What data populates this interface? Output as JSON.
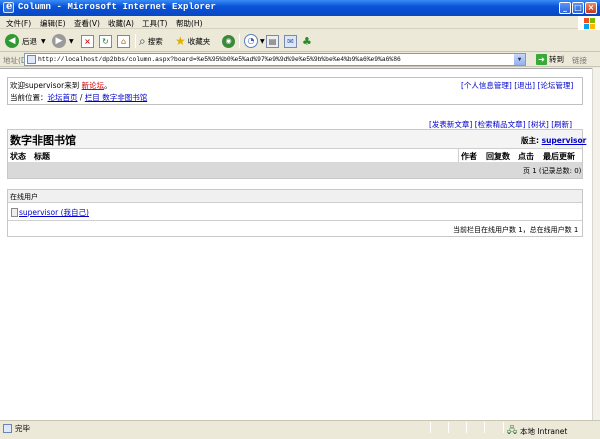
{
  "window": {
    "title": "Column - Microsoft Internet Explorer",
    "buttons": {
      "minimize": "_",
      "maximize": "□",
      "close": "×"
    }
  },
  "menu": [
    "文件(F)",
    "编辑(E)",
    "查看(V)",
    "收藏(A)",
    "工具(T)",
    "帮助(H)"
  ],
  "toolbar": {
    "back_label": "后退",
    "search_label": "搜索",
    "favorites_label": "收藏夹"
  },
  "address": {
    "label": "地址(D)",
    "url": "http://localhost/dp2bbs/column.aspx?board=%e5%95%b0%e5%ad%97%e9%9d%9e%e5%9b%be%e4%b9%a6%e9%a6%86",
    "go_label": "转到",
    "links_label": "链接"
  },
  "page": {
    "welcome_prefix": "欢迎",
    "user": "supervisor",
    "welcome_suffix": "来到",
    "forum_name": "新论坛",
    "welcome_end": "。",
    "top_links": [
      "[个人信息管理]",
      "[退出]",
      "[论坛管理]"
    ],
    "location_label": "当前位置：",
    "crumb_home": "论坛首页",
    "crumb_sep": "/",
    "crumb_column": "栏目 数字非图书馆",
    "actions": [
      "[发表新文章]",
      "[检索精品文章]",
      "[树状]",
      "[刷新]"
    ],
    "board_title": "数字非图书馆",
    "moderator_label": "版主:",
    "moderator": "supervisor",
    "columns": {
      "status": "状态",
      "title": "标题",
      "author": "作者",
      "replies": "回复数",
      "clicks": "点击",
      "last_update": "最后更新"
    },
    "page_info": "页 1 (记录总数: 0)",
    "online_header": "在线用户",
    "online_user": "supervisor (我自己)",
    "online_summary": "当前栏目在线用户数 1，总在线用户数 1"
  },
  "status": {
    "text": "完毕",
    "zone": "本地 Intranet"
  },
  "colors": {
    "titlebar": "#0a53d8",
    "link": "#0000cc",
    "forum_link": "#cc0000",
    "header_row": "#d9d9d9"
  }
}
